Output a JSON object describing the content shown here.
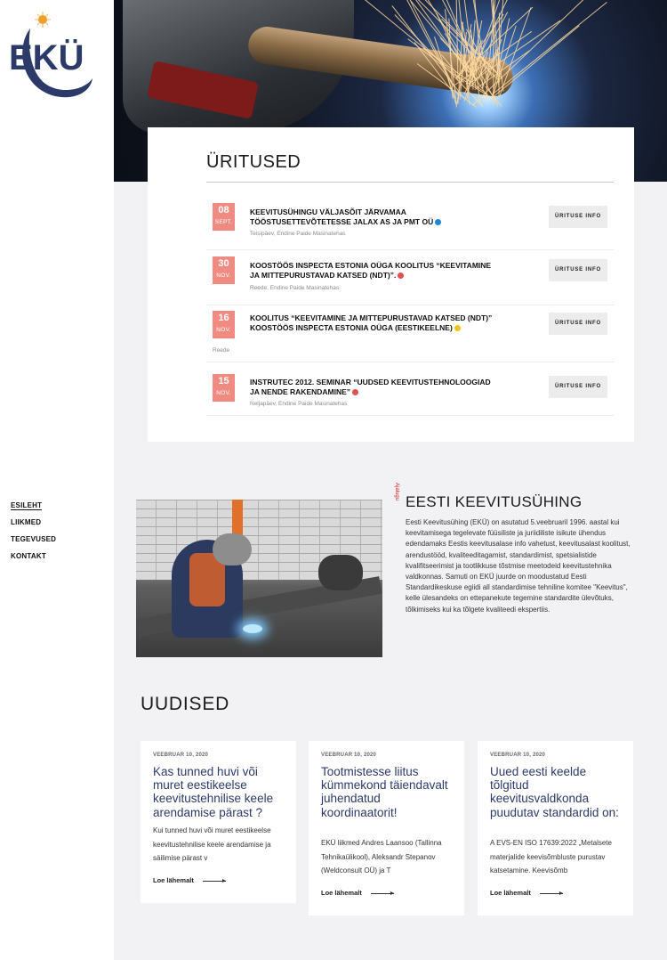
{
  "brand": {
    "logo_text": "EKÜ"
  },
  "nav": {
    "items": [
      {
        "label": "ESILEHT",
        "active": true
      },
      {
        "label": "LIIKMED",
        "active": false
      },
      {
        "label": "TEGEVUSED",
        "active": false
      },
      {
        "label": "KONTAKT",
        "active": false
      }
    ]
  },
  "events": {
    "heading": "ÜRITUSED",
    "button_label": "ÜRITUSE INFO",
    "items": [
      {
        "day": "08",
        "month": "SEPT.",
        "title": "KEEVITUSÜHINGU VÄLJASÕIT JÄRVAMAA TÖÖSTUSETTEVÕTETESSE JALAX AS JA PMT OÜ",
        "meta": "Teisipäev, Endine Paide Masinatehas",
        "dot_color": "#1e88d8"
      },
      {
        "day": "30",
        "month": "NOV.",
        "title": "KOOSTÖÖS INSPECTA ESTONIA OÜGA KOOLITUS “KEEVITAMINE JA MITTEPURUSTAVAD KATSED (NDT)”.",
        "meta": "Reede, Endine Paide Masinatehas",
        "dot_color": "#e05050"
      },
      {
        "day": "16",
        "month": "NOV.",
        "title": "KOOLITUS “KEEVITAMINE JA MITTEPURUSTAVAD KATSED (NDT)” KOOSTÖÖS INSPECTA ESTONIA OÜGA (EESTIKEELNE)",
        "meta": "Reede",
        "dot_color": "#f0c419"
      },
      {
        "day": "15",
        "month": "NOV.",
        "title": "INSTRUTEC 2012. SEMINAR “UUDSED KEEVITUSTEHNOLOOGIAD JA NENDE RAKENDAMINE”",
        "meta": "Neljapäev, Endine Paide Masinatehas",
        "dot_color": "#e05050"
      }
    ]
  },
  "about": {
    "side_label": "Ajalugu",
    "title": "EESTI KEEVITUSÜHING",
    "text": "Eesti Keevitusühing (EKÜ) on asutatud 5.veebruaril 1996. aastal kui keevitamisega tegelevate füüsiliste ja juriidiliste isikute ühendus edendamaks Eestis keevitusalase info vahetust, keevitusalast koolitust, arendustööd, kvaliteeditagamist, standardimist, spetsialistide kvalifitseerimist ja tootlikkuse tõstmise meetodeid keevitustehnika valdkonnas. Samuti on EKÜ juurde on moodustatud Eesti Standardikeskuse egiidi all standardimise tehniline komitee \"Keevitus\", kelle ülesandeks on ettepanekute tegemine standardite ülevõtuks, tõlkimiseks kui ka tõlgete kvaliteedi ekspertiis."
  },
  "news": {
    "heading": "UUDISED",
    "more_label": "Loe lähemalt",
    "cards": [
      {
        "date": "VEEBRUAR 10, 2020",
        "title": "Kas tunned huvi või muret eestikeelse keevitustehnilise keele arendamise pärast ?",
        "excerpt": "Kui tunned huvi või muret eestikeelse keevitustehnilise keele arendamise ja säilimise pärast v"
      },
      {
        "date": "VEEBRUAR 10, 2020",
        "title": "Tootmistesse liitus kümmekond täiendavalt juhendatud koordinaatorit!",
        "excerpt": "EKÜ liikmed Andres Laansoo (Tallinna Tehnikaülikool), Aleksandr Stepanov (Weldconsult OÜ) ja T"
      },
      {
        "date": "VEEBRUAR 10, 2020",
        "title": "Uued eesti keelde tõlgitud keevitusvaldkonda puudutav standardid on:",
        "excerpt": "A EVS-EN ISO 17639:2022 „Metalsete materjalide keevisõmbluste purustav katsetamine. Keevisõmb"
      }
    ]
  },
  "colors": {
    "accent": "#f08b82",
    "logo_blue": "#2c3a6a",
    "card_title": "#2c3a6a"
  }
}
